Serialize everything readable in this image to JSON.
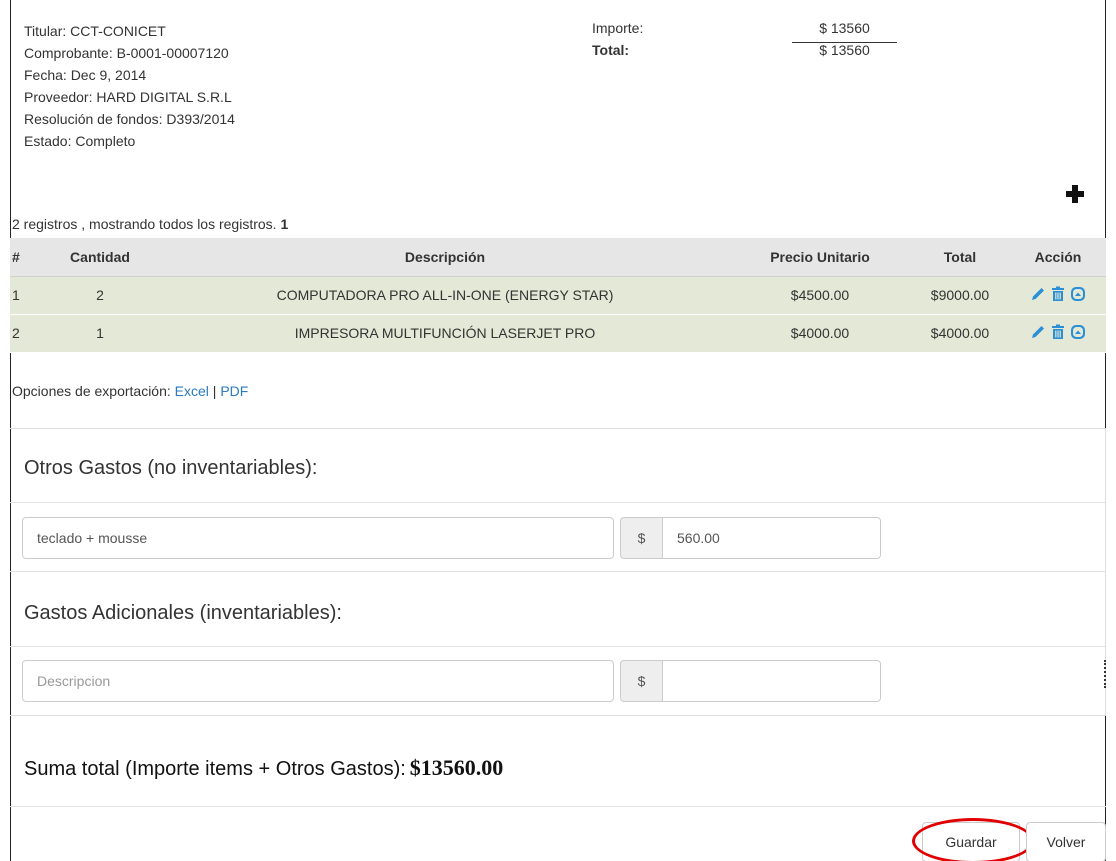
{
  "info": {
    "titular": "Titular: CCT-CONICET",
    "comprobante": "Comprobante: B-0001-00007120",
    "fecha": "Fecha: Dec 9, 2014",
    "proveedor": "Proveedor: HARD DIGITAL S.R.L",
    "resolucion": "Resolución de fondos: D393/2014",
    "estado": "Estado: Completo"
  },
  "amounts": {
    "importe_label": "Importe:",
    "importe_value": "$ 13560",
    "total_label": "Total:",
    "total_value": "$ 13560"
  },
  "registros": {
    "text": "2 registros , mostrando todos los registros.",
    "page": "1"
  },
  "table": {
    "headers": [
      "#",
      "Cantidad",
      "Descripción",
      "Precio Unitario",
      "Total",
      "Acción"
    ],
    "rows": [
      [
        "1",
        "2",
        "COMPUTADORA PRO ALL-IN-ONE (ENERGY STAR)",
        "$4500.00",
        "$9000.00"
      ],
      [
        "2",
        "1",
        "IMPRESORA MULTIFUNCIÓN LASERJET PRO",
        "$4000.00",
        "$4000.00"
      ]
    ]
  },
  "export": {
    "label": "Opciones de exportación:",
    "excel": "Excel",
    "separator": "|",
    "pdf": "PDF"
  },
  "otros": {
    "title": "Otros Gastos (no inventariables):",
    "desc_value": "teclado + mousse",
    "currency": "$",
    "amount_value": "560.00"
  },
  "adicionales": {
    "title": "Gastos Adicionales (inventariables):",
    "desc_placeholder": "Descripcion",
    "currency": "$",
    "amount_value": ""
  },
  "summary": {
    "label": "Suma total (Importe items + Otros Gastos):",
    "amount": "$13560.00"
  },
  "buttons": {
    "guardar": "Guardar",
    "volver": "Volver"
  },
  "colors": {
    "link": "#2a7ac0",
    "icon": "#2a8fd6",
    "row_bg": "#e4e8d6",
    "highlight": "#e00000"
  },
  "icons": [
    "pencil-icon",
    "trash-icon",
    "circle-up-icon",
    "plus-icon"
  ]
}
